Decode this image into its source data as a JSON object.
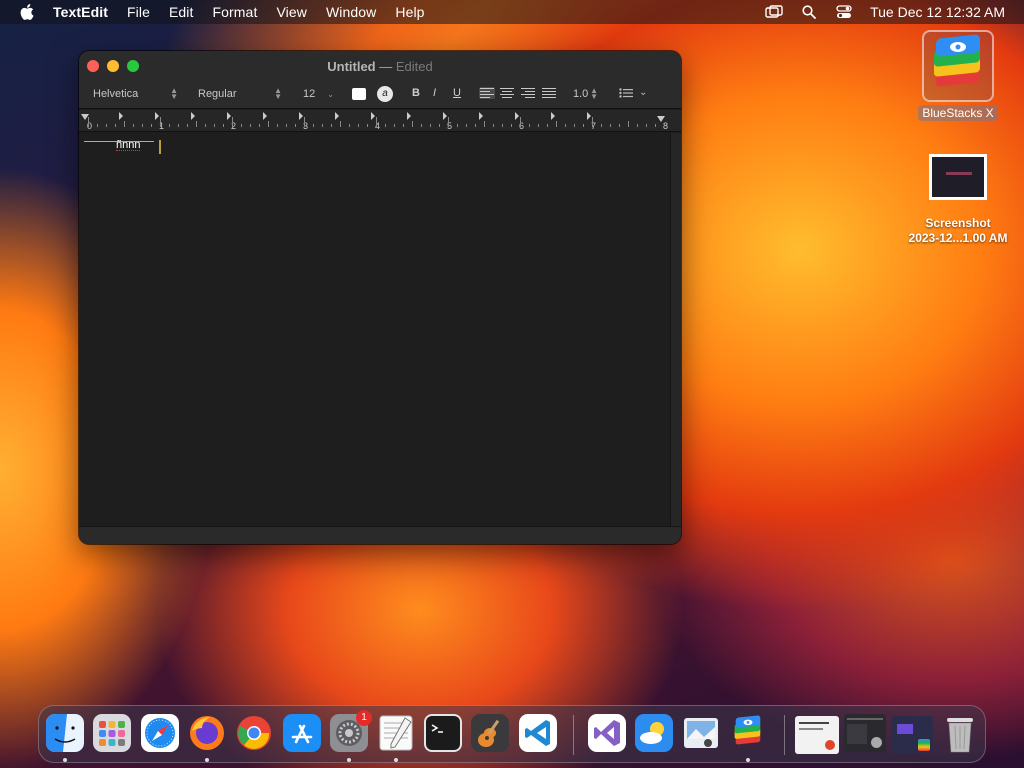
{
  "menubar": {
    "app_name": "TextEdit",
    "items": [
      "File",
      "Edit",
      "Format",
      "View",
      "Window",
      "Help"
    ],
    "clock": "Tue Dec 12  12:32 AM",
    "status_icons": [
      "screen-mirroring-icon",
      "spotlight-search-icon",
      "control-center-icon"
    ]
  },
  "desktop": {
    "bluestacks": {
      "label": "BlueStacks X"
    },
    "screenshot": {
      "line1": "Screenshot",
      "line2": "2023-12...1.00 AM"
    }
  },
  "window": {
    "title": "Untitled",
    "separator": "—",
    "status": "Edited",
    "toolbar": {
      "font_family": "Helvetica",
      "font_style": "Regular",
      "font_size": "12",
      "highlight_label": "a",
      "bold_label": "B",
      "italic_label": "I",
      "underline_label": "U",
      "line_spacing": "1.0"
    },
    "ruler_numbers": [
      "0",
      "1",
      "2",
      "3",
      "4",
      "5",
      "6",
      "7",
      "8"
    ],
    "document_text": "ñnnn"
  },
  "dock": {
    "apps": [
      {
        "name": "Finder",
        "icon": "finder-icon",
        "running": true
      },
      {
        "name": "Launchpad",
        "icon": "launchpad-icon",
        "running": false
      },
      {
        "name": "Safari",
        "icon": "safari-icon",
        "running": false
      },
      {
        "name": "Firefox",
        "icon": "firefox-icon",
        "running": true
      },
      {
        "name": "Google Chrome",
        "icon": "chrome-icon",
        "running": false
      },
      {
        "name": "App Store",
        "icon": "app-store-icon",
        "running": false
      },
      {
        "name": "System Settings",
        "icon": "system-settings-icon",
        "running": true,
        "badge": "1"
      },
      {
        "name": "TextEdit",
        "icon": "textedit-icon",
        "running": true
      },
      {
        "name": "Terminal",
        "icon": "terminal-icon",
        "running": false
      },
      {
        "name": "GarageBand",
        "icon": "garageband-icon",
        "running": false
      },
      {
        "name": "Visual Studio Code",
        "icon": "vscode-icon",
        "running": false
      },
      {
        "name": "Visual Studio",
        "icon": "visual-studio-icon",
        "running": false
      },
      {
        "name": "Weather",
        "icon": "weather-icon",
        "running": false
      },
      {
        "name": "Preview",
        "icon": "preview-icon",
        "running": false
      },
      {
        "name": "BlueStacks X",
        "icon": "bluestacks-icon",
        "running": true
      }
    ],
    "minimized": [
      "minimized-window-1",
      "minimized-window-2",
      "minimized-window-3"
    ],
    "trash": {
      "name": "Trash",
      "icon": "trash-icon"
    }
  }
}
